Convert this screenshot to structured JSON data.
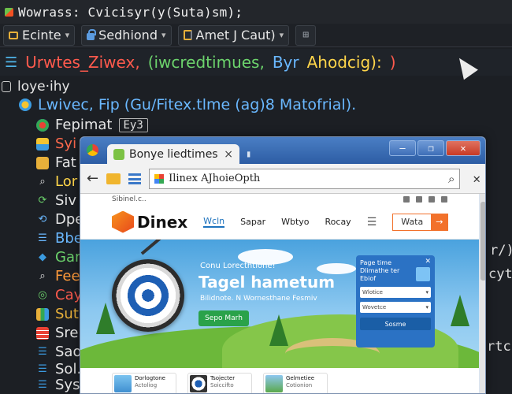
{
  "window": {
    "title": "Wowrass: Cvicisyr(y(Suta)sm);"
  },
  "toolbar": {
    "items": [
      {
        "label": "Ecinte"
      },
      {
        "label": "Sedhiond"
      },
      {
        "label": "Amet J Caut)"
      }
    ]
  },
  "command": {
    "parts": [
      "Urwtes_Ziwex,",
      "(iwcredtimues,",
      "Byr",
      "Ahodcig):",
      ")"
    ]
  },
  "tree": {
    "root": "loye·ihy",
    "project": "Lwivec, Fip (Gu/Fitex.tlme (ag)8 Matofrial).",
    "first_child": {
      "label": "Fepimat",
      "badge": "Ey3"
    },
    "children": [
      "Syi",
      "Fat",
      "Lor",
      "Siv",
      "Dpe",
      "Bbe",
      "Gan",
      "Fee",
      "Cay",
      "Sut",
      "Sre",
      "Sao",
      "Sol.",
      "Sys"
    ]
  },
  "right_fragments": [
    "r/)",
    "cyt)",
    "rtc)"
  ],
  "browser": {
    "tab_title": "Bonye liedtimes",
    "tab_close": "×",
    "address": "Ilinex AJhoieOpth",
    "site": {
      "topbar": "Sibinel.c..",
      "brand": "Dinex",
      "nav": [
        "Wcln",
        "Sapar",
        "Wbtyo",
        "Rocay"
      ],
      "cta_label": "Wata",
      "cta_arrow": "→",
      "hero": {
        "kicker": "Conu Lorecthtione!",
        "title": "Tagel hametum",
        "subtitle": "Bilidnote. N Wornesthane Fesmiv",
        "button": "Sepo Marh"
      },
      "form": {
        "title": "Page time Dlimathe ter Ebiof",
        "field1": "Wlotice",
        "field2": "Wovetce",
        "submit": "Sosme"
      },
      "cards": [
        {
          "title": "Dorlogtone",
          "sub": "Actoliog"
        },
        {
          "title": "Tsojecter",
          "sub": "Soiccifto"
        },
        {
          "title": "Gelmetiee",
          "sub": "Cotionion"
        }
      ]
    }
  },
  "colors": {
    "accent_red": "#ff5a4d",
    "accent_green": "#6cd36c",
    "accent_blue": "#6ab8ff",
    "accent_yellow": "#ffd54a",
    "brand_orange": "#f2712b"
  }
}
